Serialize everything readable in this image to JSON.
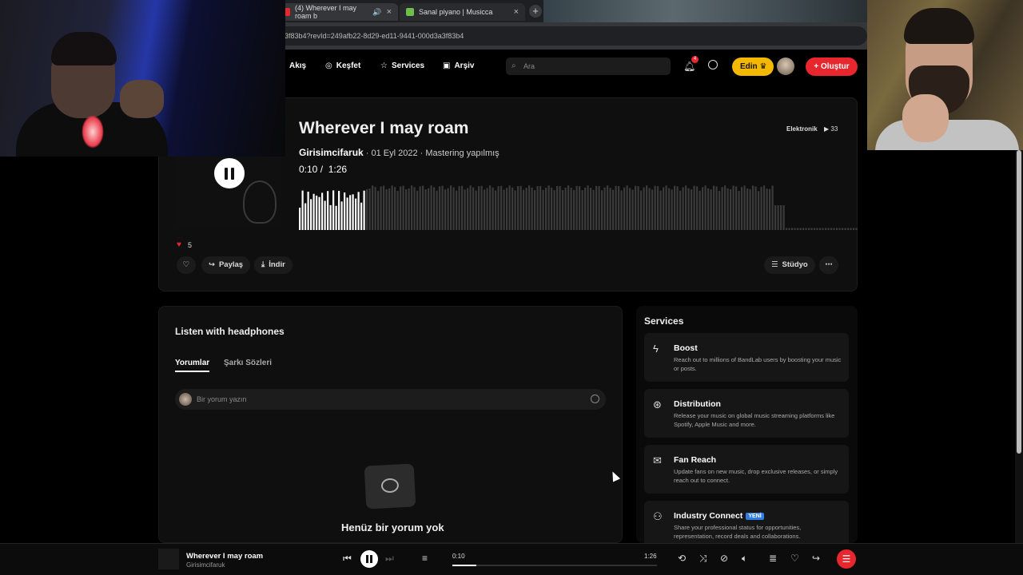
{
  "browser": {
    "tabs": [
      {
        "title": "(4) Wherever I may roam b",
        "active": true
      },
      {
        "title": "Sanal piyano | Musicca",
        "active": false
      }
    ],
    "url": "3f83b4?revId=249afb22-8d29-ed11-9441-000d3a3f83b4"
  },
  "nav": {
    "items": [
      "Akış",
      "Keşfet",
      "Services",
      "Arşiv"
    ],
    "search_placeholder": "Ara",
    "notifications": "4",
    "edin_label": "Edin",
    "create_label": "Oluştur"
  },
  "track": {
    "title": "Wherever I may roam",
    "artist": "Girisimcifaruk",
    "meta": "· 01 Eyl 2022 · Mastering yapılmış",
    "current_time": "0:10 /",
    "duration": "1:26",
    "genre": "Elektronik",
    "plays": "33",
    "likes": "5",
    "progress": 0.116,
    "actions": {
      "share": "Paylaş",
      "download": "İndir",
      "studio": "Stüdyo"
    }
  },
  "comments": {
    "title": "Listen with headphones",
    "tabs": [
      "Yorumlar",
      "Şarkı Sözleri"
    ],
    "placeholder": "Bir yorum yazın",
    "empty_text": "Henüz bir yorum yok"
  },
  "services": {
    "title": "Services",
    "items": [
      {
        "name": "Boost",
        "desc": "Reach out to millions of BandLab users by boosting your music or posts.",
        "icon": "lightning-icon"
      },
      {
        "name": "Distribution",
        "desc": "Release your music on global music streaming platforms like Spotify, Apple Music and more.",
        "icon": "distribution-icon"
      },
      {
        "name": "Fan Reach",
        "desc": "Update fans on new music, drop exclusive releases, or simply reach out to connect.",
        "icon": "mail-icon"
      },
      {
        "name": "Industry Connect",
        "badge": "YENİ",
        "desc": "Share your professional status for opportunities, representation, record deals and collaborations.",
        "icon": "people-icon"
      }
    ]
  },
  "player": {
    "title": "Wherever I may roam",
    "artist": "Girisimcifaruk",
    "current": "0:10",
    "duration": "1:26"
  },
  "colors": {
    "accent": "#e8262d",
    "gold": "#f5b800",
    "badge": "#2f7de1"
  }
}
